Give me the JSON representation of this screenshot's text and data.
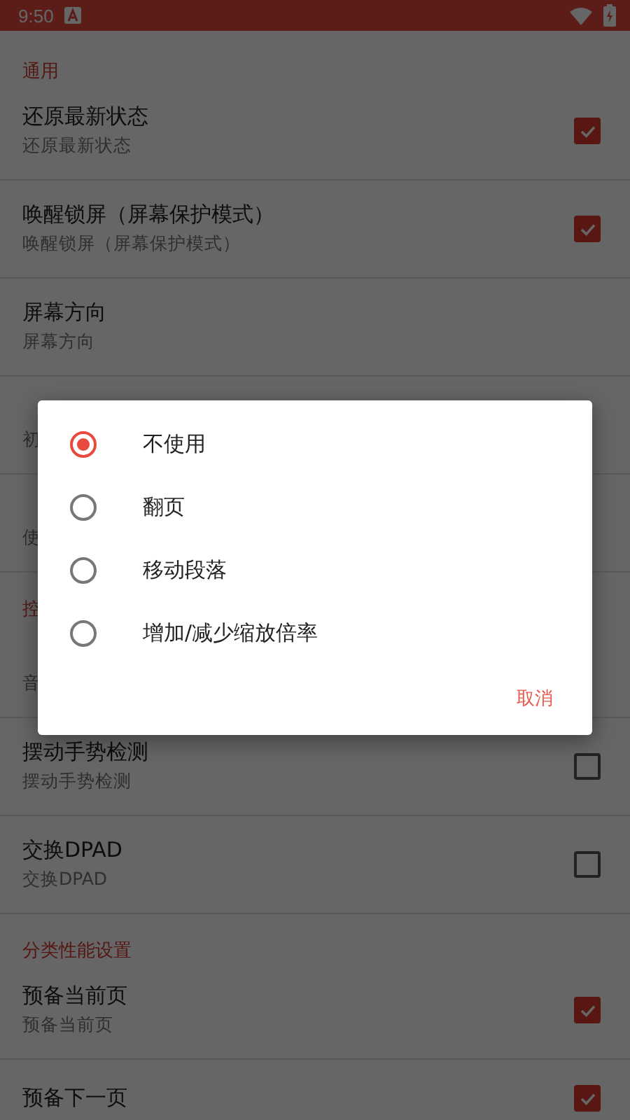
{
  "status_bar": {
    "time": "9:50"
  },
  "settings": [
    {
      "kind": "section",
      "title": "通用"
    },
    {
      "kind": "checkbox",
      "title": "还原最新状态",
      "subtitle": "还原最新状态",
      "checked": true
    },
    {
      "kind": "checkbox",
      "title": "唤醒锁屏（屏幕保护模式）",
      "subtitle": "唤醒锁屏（屏幕保护模式）",
      "checked": true
    },
    {
      "kind": "plain",
      "title": "屏幕方向",
      "subtitle": "屏幕方向"
    },
    {
      "kind": "plain",
      "subtitle": "初"
    },
    {
      "kind": "plain",
      "subtitle": "使"
    },
    {
      "kind": "section",
      "title": "控"
    },
    {
      "kind": "plain",
      "subtitle": "音"
    },
    {
      "kind": "checkbox",
      "title": "摆动手势检测",
      "subtitle": "摆动手势检测",
      "checked": false
    },
    {
      "kind": "checkbox",
      "title": "交换DPAD",
      "subtitle": "交换DPAD",
      "checked": false
    },
    {
      "kind": "section",
      "title": "分类性能设置"
    },
    {
      "kind": "checkbox",
      "title": "预备当前页",
      "subtitle": "预备当前页",
      "checked": true
    },
    {
      "kind": "checkbox",
      "title": "预备下一页",
      "checked": true
    }
  ],
  "dialog": {
    "options": [
      {
        "label": "不使用",
        "selected": true
      },
      {
        "label": "翻页",
        "selected": false
      },
      {
        "label": "移动段落",
        "selected": false
      },
      {
        "label": "增加/减少缩放倍率",
        "selected": false
      }
    ],
    "buttons": [
      "取消"
    ]
  }
}
